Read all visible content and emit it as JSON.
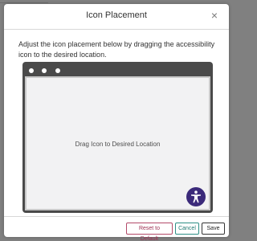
{
  "modal": {
    "title": "Icon Placement",
    "close_glyph": "×",
    "instructions": "Adjust the icon placement below by dragging the accessibility icon to the desired location."
  },
  "preview": {
    "drop_label": "Drag Icon to Desired Location",
    "icon": "accessibility-icon",
    "icon_color": "#3b2a7a"
  },
  "footer": {
    "reset_label": "Reset to Default",
    "cancel_label": "Cancel",
    "save_label": "Save",
    "reset_color": "#9e2f52",
    "cancel_color": "#227a72"
  }
}
